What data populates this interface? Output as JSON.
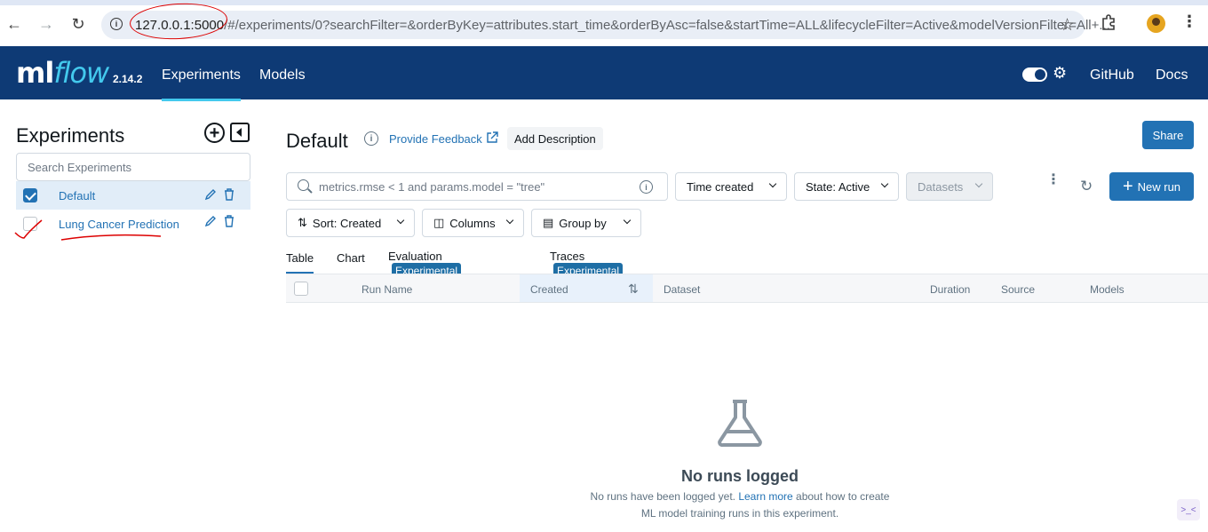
{
  "browser": {
    "url_host": "127.0.0.1:5000",
    "url_rest": "/#/experiments/0?searchFilter=&orderByKey=attributes.start_time&orderByAsc=false&startTime=ALL&lifecycleFilter=Active&modelVersionFilter=All+..."
  },
  "header": {
    "logo_ml": "ml",
    "logo_flow": "flow",
    "version": "2.14.2",
    "nav": [
      "Experiments",
      "Models"
    ],
    "right_links": [
      "GitHub",
      "Docs"
    ]
  },
  "sidebar": {
    "title": "Experiments",
    "search_placeholder": "Search Experiments",
    "experiments": [
      {
        "name": "Default",
        "checked": true
      },
      {
        "name": "Lung Cancer Prediction",
        "checked": false
      }
    ]
  },
  "main": {
    "title": "Default",
    "feedback_label": "Provide Feedback",
    "add_description_label": "Add Description",
    "share_label": "Share",
    "search_placeholder": "metrics.rmse < 1 and params.model = \"tree\"",
    "filters": {
      "time_created": "Time created",
      "state": "State: Active",
      "datasets": "Datasets"
    },
    "new_run_label": "New run",
    "controls": {
      "sort": "Sort: Created",
      "columns": "Columns",
      "group_by": "Group by"
    },
    "tabs": [
      {
        "label": "Table"
      },
      {
        "label": "Chart"
      },
      {
        "label": "Evaluation",
        "badge": "Experimental"
      },
      {
        "label": "Traces",
        "badge": "Experimental"
      }
    ],
    "columns": [
      "Run Name",
      "Created",
      "Dataset",
      "Duration",
      "Source",
      "Models"
    ],
    "empty": {
      "title": "No runs logged",
      "desc_before": "No runs have been logged yet. ",
      "learn_more": "Learn more",
      "desc_after": " about how to create ML model training runs in this experiment."
    }
  },
  "colors": {
    "header_bg": "#0e3a75",
    "accent": "#2272b4",
    "logo_flow": "#43c9ed"
  }
}
